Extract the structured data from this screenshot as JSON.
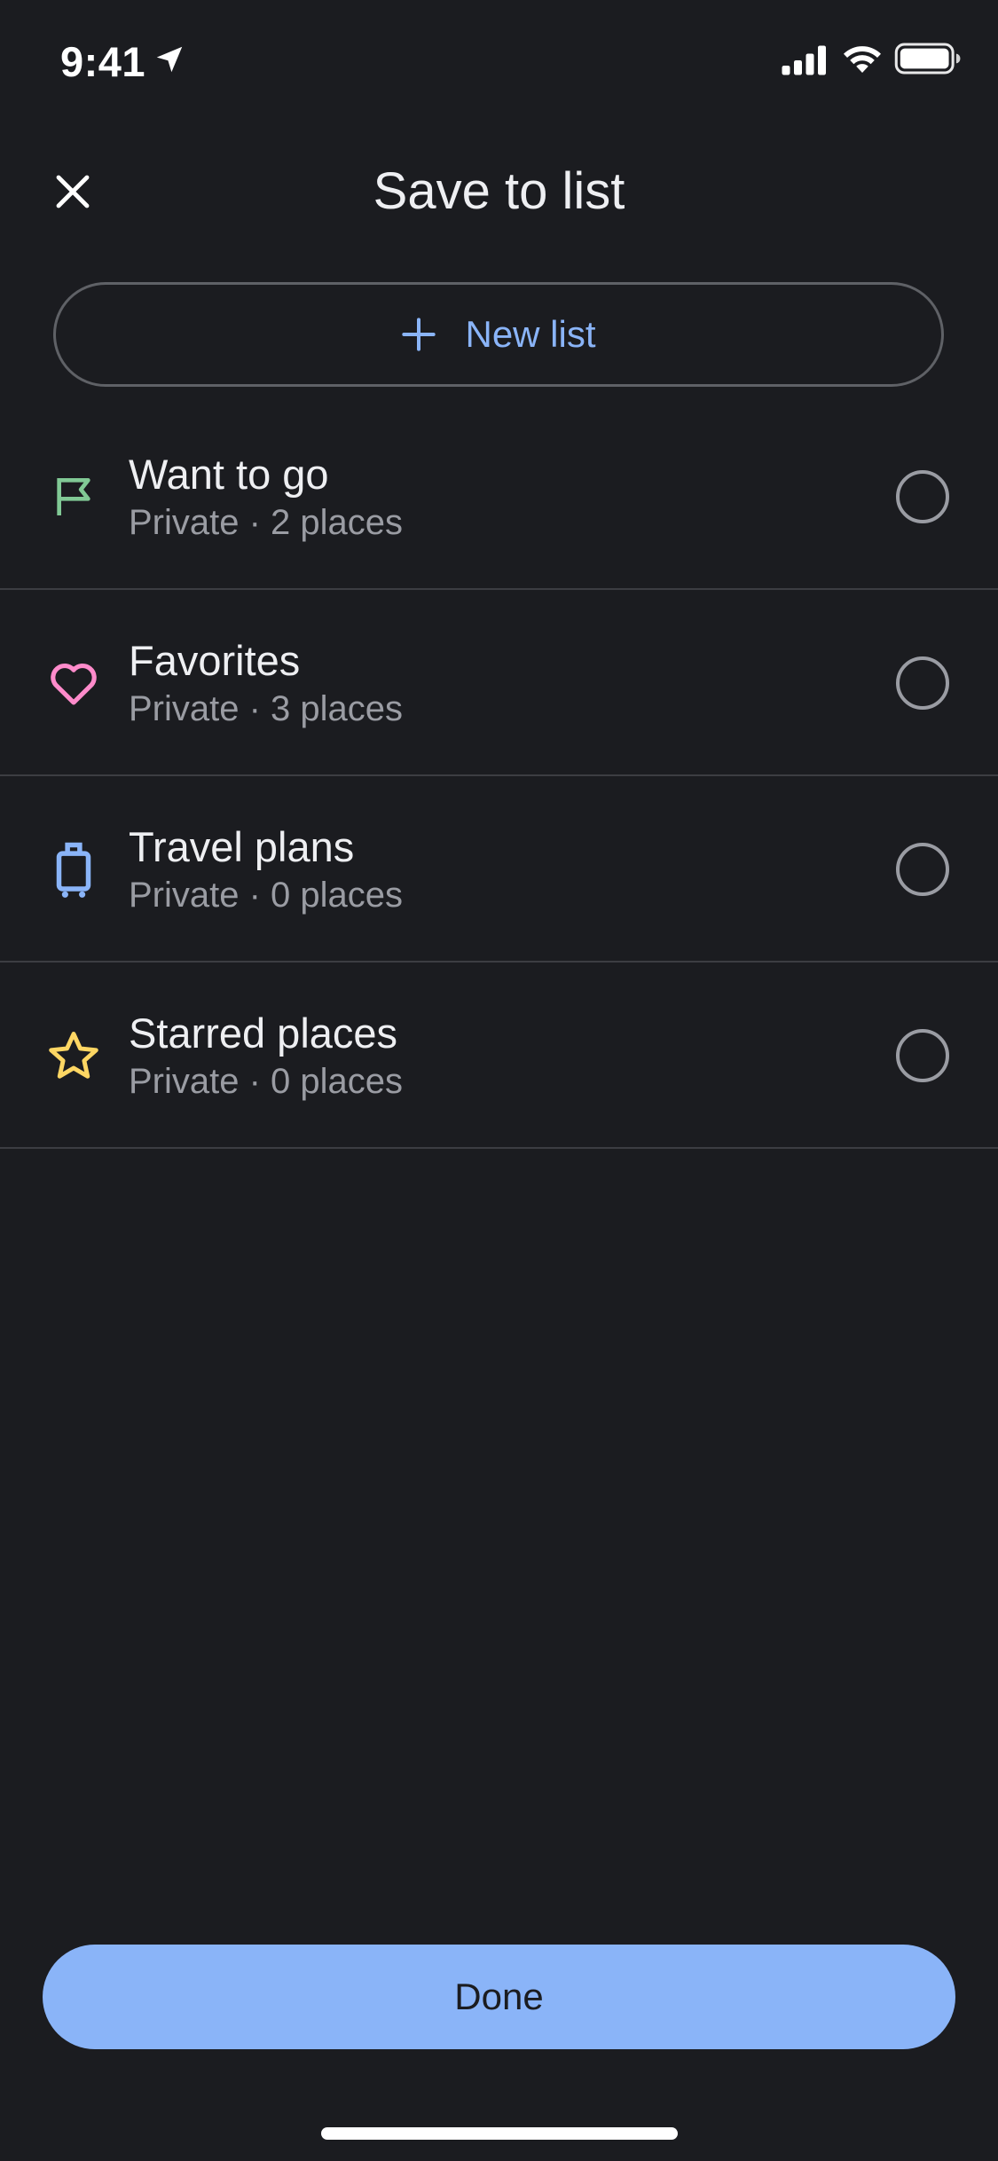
{
  "status_bar": {
    "time": "9:41",
    "icons": [
      "location-arrow-icon",
      "signal-icon",
      "wifi-icon",
      "battery-icon"
    ]
  },
  "header": {
    "title": "Save to list",
    "close_icon": "close-icon"
  },
  "new_list": {
    "label": "New list",
    "icon": "plus-icon"
  },
  "lists": [
    {
      "title": "Want to go",
      "subtitle": "Private · 2 places",
      "icon": "flag-icon",
      "color": "#81c995",
      "selected": false
    },
    {
      "title": "Favorites",
      "subtitle": "Private · 3 places",
      "icon": "heart-icon",
      "color": "#ff8bcb",
      "selected": false
    },
    {
      "title": "Travel plans",
      "subtitle": "Private · 0 places",
      "icon": "suitcase-icon",
      "color": "#8ab4f8",
      "selected": false
    },
    {
      "title": "Starred places",
      "subtitle": "Private · 0 places",
      "icon": "star-icon",
      "color": "#fdd663",
      "selected": false
    }
  ],
  "done_button": {
    "label": "Done"
  },
  "colors": {
    "background": "#1b1c20",
    "accent": "#8ab4f8",
    "divider": "#3c3d42",
    "secondary_text": "#9a9ca3"
  }
}
